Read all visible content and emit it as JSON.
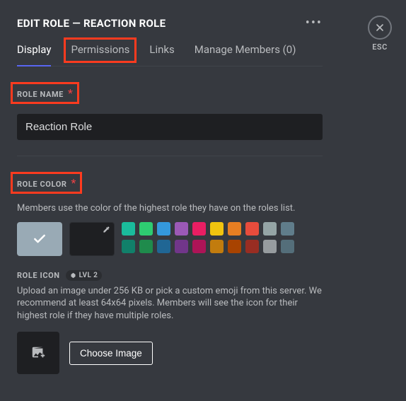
{
  "header": {
    "title": "EDIT ROLE — REACTION ROLE",
    "esc_label": "ESC"
  },
  "tabs": {
    "display": "Display",
    "permissions": "Permissions",
    "links": "Links",
    "manage": "Manage Members (0)"
  },
  "role_name": {
    "label": "ROLE NAME",
    "value": "Reaction Role"
  },
  "role_color": {
    "label": "ROLE COLOR",
    "description": "Members use the color of the highest role they have on the roles list.",
    "default_color": "#99aab5",
    "palette_row1": [
      "#1abc9c",
      "#2ecc71",
      "#3498db",
      "#9b59b6",
      "#e91e63",
      "#f1c40f",
      "#e67e22",
      "#e74c3c",
      "#95a5a6",
      "#607d8b"
    ],
    "palette_row2": [
      "#11806a",
      "#1f8b4c",
      "#206694",
      "#71368a",
      "#ad1457",
      "#c27c0e",
      "#a84300",
      "#992d22",
      "#979c9f",
      "#546e7a"
    ]
  },
  "role_icon": {
    "label": "ROLE ICON",
    "level_badge": "LVL 2",
    "description": "Upload an image under 256 KB or pick a custom emoji from this server. We recommend at least 64x64 pixels. Members will see the icon for their highest role if they have multiple roles.",
    "choose_label": "Choose Image"
  }
}
